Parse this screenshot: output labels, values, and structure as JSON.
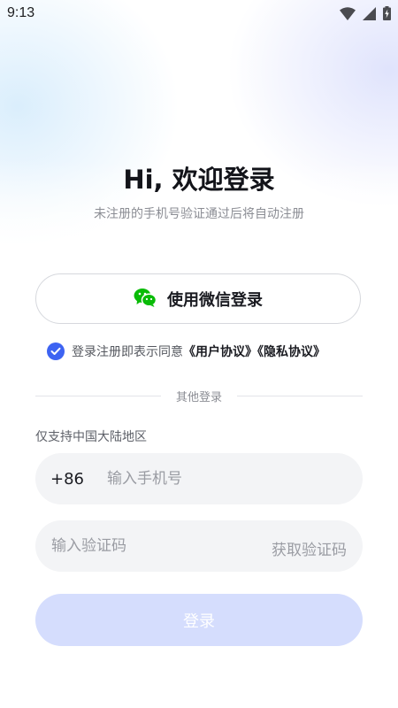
{
  "status_bar": {
    "time": "9:13",
    "icons": [
      "wifi-icon",
      "signal-icon",
      "battery-charging-icon"
    ]
  },
  "header": {
    "title": "Hi, 欢迎登录",
    "subtitle": "未注册的手机号验证通过后将自动注册"
  },
  "wechat_login": {
    "label": "使用微信登录",
    "icon": "wechat-icon",
    "icon_color": "#09bb07"
  },
  "agreement": {
    "checked": true,
    "prefix": "登录注册即表示同意",
    "user_agreement": "《用户协议》",
    "privacy_agreement": "《隐私协议》",
    "check_color": "#3d63f2"
  },
  "divider": {
    "label": "其他登录"
  },
  "phone_login": {
    "region_note": "仅支持中国大陆地区",
    "country_code": "+86",
    "phone_placeholder": "输入手机号",
    "code_placeholder": "输入验证码",
    "get_code_label": "获取验证码",
    "submit_label": "登录",
    "submit_color": "#d5ddfd"
  }
}
